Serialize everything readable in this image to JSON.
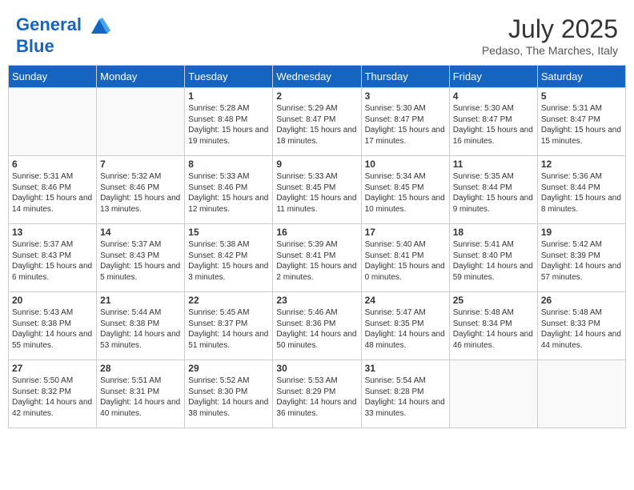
{
  "header": {
    "logo_line1": "General",
    "logo_line2": "Blue",
    "month_year": "July 2025",
    "location": "Pedaso, The Marches, Italy"
  },
  "weekdays": [
    "Sunday",
    "Monday",
    "Tuesday",
    "Wednesday",
    "Thursday",
    "Friday",
    "Saturday"
  ],
  "weeks": [
    [
      {
        "day": "",
        "info": ""
      },
      {
        "day": "",
        "info": ""
      },
      {
        "day": "1",
        "info": "Sunrise: 5:28 AM\nSunset: 8:48 PM\nDaylight: 15 hours and 19 minutes."
      },
      {
        "day": "2",
        "info": "Sunrise: 5:29 AM\nSunset: 8:47 PM\nDaylight: 15 hours and 18 minutes."
      },
      {
        "day": "3",
        "info": "Sunrise: 5:30 AM\nSunset: 8:47 PM\nDaylight: 15 hours and 17 minutes."
      },
      {
        "day": "4",
        "info": "Sunrise: 5:30 AM\nSunset: 8:47 PM\nDaylight: 15 hours and 16 minutes."
      },
      {
        "day": "5",
        "info": "Sunrise: 5:31 AM\nSunset: 8:47 PM\nDaylight: 15 hours and 15 minutes."
      }
    ],
    [
      {
        "day": "6",
        "info": "Sunrise: 5:31 AM\nSunset: 8:46 PM\nDaylight: 15 hours and 14 minutes."
      },
      {
        "day": "7",
        "info": "Sunrise: 5:32 AM\nSunset: 8:46 PM\nDaylight: 15 hours and 13 minutes."
      },
      {
        "day": "8",
        "info": "Sunrise: 5:33 AM\nSunset: 8:46 PM\nDaylight: 15 hours and 12 minutes."
      },
      {
        "day": "9",
        "info": "Sunrise: 5:33 AM\nSunset: 8:45 PM\nDaylight: 15 hours and 11 minutes."
      },
      {
        "day": "10",
        "info": "Sunrise: 5:34 AM\nSunset: 8:45 PM\nDaylight: 15 hours and 10 minutes."
      },
      {
        "day": "11",
        "info": "Sunrise: 5:35 AM\nSunset: 8:44 PM\nDaylight: 15 hours and 9 minutes."
      },
      {
        "day": "12",
        "info": "Sunrise: 5:36 AM\nSunset: 8:44 PM\nDaylight: 15 hours and 8 minutes."
      }
    ],
    [
      {
        "day": "13",
        "info": "Sunrise: 5:37 AM\nSunset: 8:43 PM\nDaylight: 15 hours and 6 minutes."
      },
      {
        "day": "14",
        "info": "Sunrise: 5:37 AM\nSunset: 8:43 PM\nDaylight: 15 hours and 5 minutes."
      },
      {
        "day": "15",
        "info": "Sunrise: 5:38 AM\nSunset: 8:42 PM\nDaylight: 15 hours and 3 minutes."
      },
      {
        "day": "16",
        "info": "Sunrise: 5:39 AM\nSunset: 8:41 PM\nDaylight: 15 hours and 2 minutes."
      },
      {
        "day": "17",
        "info": "Sunrise: 5:40 AM\nSunset: 8:41 PM\nDaylight: 15 hours and 0 minutes."
      },
      {
        "day": "18",
        "info": "Sunrise: 5:41 AM\nSunset: 8:40 PM\nDaylight: 14 hours and 59 minutes."
      },
      {
        "day": "19",
        "info": "Sunrise: 5:42 AM\nSunset: 8:39 PM\nDaylight: 14 hours and 57 minutes."
      }
    ],
    [
      {
        "day": "20",
        "info": "Sunrise: 5:43 AM\nSunset: 8:38 PM\nDaylight: 14 hours and 55 minutes."
      },
      {
        "day": "21",
        "info": "Sunrise: 5:44 AM\nSunset: 8:38 PM\nDaylight: 14 hours and 53 minutes."
      },
      {
        "day": "22",
        "info": "Sunrise: 5:45 AM\nSunset: 8:37 PM\nDaylight: 14 hours and 51 minutes."
      },
      {
        "day": "23",
        "info": "Sunrise: 5:46 AM\nSunset: 8:36 PM\nDaylight: 14 hours and 50 minutes."
      },
      {
        "day": "24",
        "info": "Sunrise: 5:47 AM\nSunset: 8:35 PM\nDaylight: 14 hours and 48 minutes."
      },
      {
        "day": "25",
        "info": "Sunrise: 5:48 AM\nSunset: 8:34 PM\nDaylight: 14 hours and 46 minutes."
      },
      {
        "day": "26",
        "info": "Sunrise: 5:48 AM\nSunset: 8:33 PM\nDaylight: 14 hours and 44 minutes."
      }
    ],
    [
      {
        "day": "27",
        "info": "Sunrise: 5:50 AM\nSunset: 8:32 PM\nDaylight: 14 hours and 42 minutes."
      },
      {
        "day": "28",
        "info": "Sunrise: 5:51 AM\nSunset: 8:31 PM\nDaylight: 14 hours and 40 minutes."
      },
      {
        "day": "29",
        "info": "Sunrise: 5:52 AM\nSunset: 8:30 PM\nDaylight: 14 hours and 38 minutes."
      },
      {
        "day": "30",
        "info": "Sunrise: 5:53 AM\nSunset: 8:29 PM\nDaylight: 14 hours and 36 minutes."
      },
      {
        "day": "31",
        "info": "Sunrise: 5:54 AM\nSunset: 8:28 PM\nDaylight: 14 hours and 33 minutes."
      },
      {
        "day": "",
        "info": ""
      },
      {
        "day": "",
        "info": ""
      }
    ]
  ]
}
